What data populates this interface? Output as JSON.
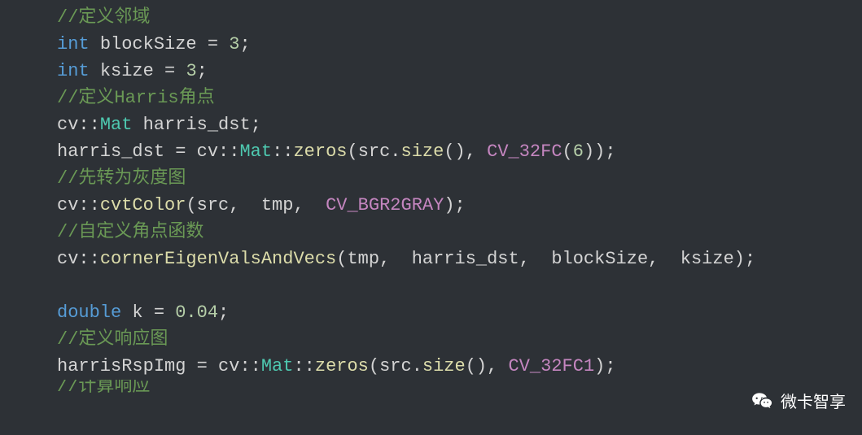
{
  "code": {
    "lines": [
      {
        "type": "comment",
        "text": "//定义邻域"
      },
      {
        "type": "declaration",
        "keyword": "int",
        "identifier": "blockSize",
        "value": "3"
      },
      {
        "type": "declaration",
        "keyword": "int",
        "identifier": "ksize",
        "value": "3"
      },
      {
        "type": "comment",
        "text": "//定义Harris角点"
      },
      {
        "type": "mat_declaration",
        "ns": "cv",
        "cls": "Mat",
        "identifier": "harris_dst"
      },
      {
        "type": "mat_zeros",
        "lhs": "harris_dst",
        "ns": "cv",
        "cls": "Mat",
        "fn": "zeros",
        "arg_obj": "src",
        "arg_fn": "size",
        "macro": "CV_32FC",
        "macro_arg": "6"
      },
      {
        "type": "comment",
        "text": "//先转为灰度图"
      },
      {
        "type": "cvt_color",
        "ns": "cv",
        "fn": "cvtColor",
        "arg1": "src",
        "arg2": "tmp",
        "macro": "CV_BGR2GRAY"
      },
      {
        "type": "comment",
        "text": "//自定义角点函数"
      },
      {
        "type": "corner_call",
        "ns": "cv",
        "fn": "cornerEigenValsAndVecs",
        "arg1": "tmp",
        "arg2": "harris_dst",
        "arg3": "blockSize",
        "arg4": "ksize"
      },
      {
        "type": "blank"
      },
      {
        "type": "declaration",
        "keyword": "double",
        "identifier": "k",
        "value": "0.04"
      },
      {
        "type": "comment",
        "text": "//定义响应图"
      },
      {
        "type": "mat_zeros2",
        "lhs": "harrisRspImg",
        "ns": "cv",
        "cls": "Mat",
        "fn": "zeros",
        "arg_obj": "src",
        "arg_fn": "size",
        "macro": "CV_32FC1"
      },
      {
        "type": "comment_partial",
        "text": "//计算响应"
      }
    ]
  },
  "watermark": {
    "text": "微卡智享"
  }
}
